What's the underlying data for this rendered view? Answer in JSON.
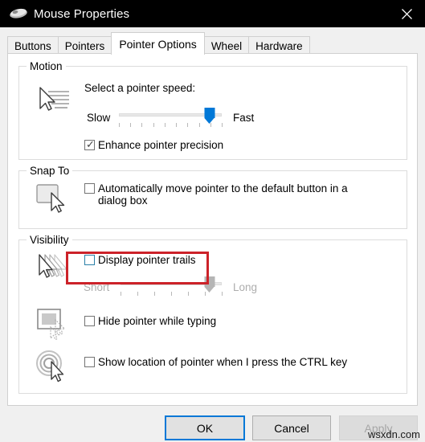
{
  "window": {
    "title": "Mouse Properties",
    "icon": "mouse-icon",
    "close_label": "✕"
  },
  "tabs": [
    {
      "label": "Buttons",
      "selected": false
    },
    {
      "label": "Pointers",
      "selected": false
    },
    {
      "label": "Pointer Options",
      "selected": true
    },
    {
      "label": "Wheel",
      "selected": false
    },
    {
      "label": "Hardware",
      "selected": false
    }
  ],
  "groups": {
    "motion": {
      "label": "Motion",
      "icon": "pointer-speed-icon",
      "prompt": "Select a pointer speed:",
      "slider": {
        "min_label": "Slow",
        "max_label": "Fast",
        "value_percent": 88,
        "tick_count": 10,
        "enabled": true,
        "accent": "#0078d7"
      },
      "checkbox": {
        "label": "Enhance pointer precision",
        "checked": true,
        "check_glyph": "✓"
      }
    },
    "snap_to": {
      "label": "Snap To",
      "icon": "snap-to-button-icon",
      "checkbox": {
        "label": "Automatically move pointer to the default button in a dialog box",
        "checked": false
      }
    },
    "visibility": {
      "label": "Visibility",
      "trails": {
        "icon": "pointer-trails-icon",
        "checkbox": {
          "label": "Display pointer trails",
          "checked": false,
          "focused": true
        },
        "slider": {
          "min_label": "Short",
          "max_label": "Long",
          "value_percent": 88,
          "tick_count": 7,
          "enabled": false
        }
      },
      "hide_typing": {
        "icon": "hide-pointer-typing-icon",
        "checkbox": {
          "label": "Hide pointer while typing",
          "checked": false
        }
      },
      "show_location": {
        "icon": "show-pointer-location-icon",
        "checkbox": {
          "label": "Show location of pointer when I press the CTRL key",
          "checked": false
        }
      }
    }
  },
  "annotation": {
    "color": "#cc2229",
    "target": "display-pointer-trails-checkbox"
  },
  "footer": {
    "ok": "OK",
    "cancel": "Cancel",
    "apply": "Apply",
    "apply_enabled": false
  },
  "watermark": "wsxdn.com"
}
